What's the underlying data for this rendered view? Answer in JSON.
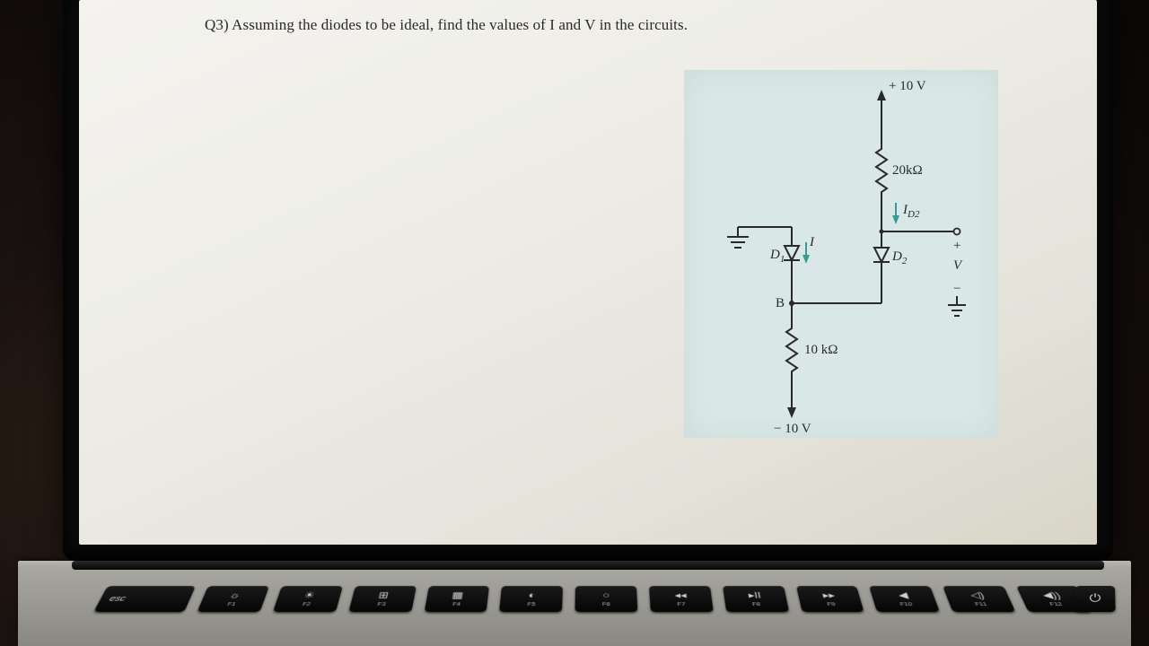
{
  "question": {
    "label": "Q3)",
    "text": "Assuming the diodes to be ideal, find the values of I and V in the circuits."
  },
  "circuit": {
    "top_voltage": "+ 10 V",
    "bottom_voltage": "− 10 V",
    "r_top": "20kΩ",
    "r_bottom": "10 kΩ",
    "i_d2": "I",
    "i_d2_sub": "D2",
    "d1": "D",
    "d1_sub": "1",
    "d2": "D",
    "d2_sub": "2",
    "i_label": "I",
    "v_label": "V",
    "node_b": "B",
    "plus": "+",
    "minus": "−"
  },
  "keyboard": {
    "esc": "esc",
    "keys": [
      {
        "sym": "☼",
        "fn": "F1"
      },
      {
        "sym": "☀",
        "fn": "F2"
      },
      {
        "sym": "⊞",
        "fn": "F3"
      },
      {
        "sym": "▦",
        "fn": "F4"
      },
      {
        "sym": "◐",
        "fn": "F5"
      },
      {
        "sym": "○",
        "fn": "F6"
      },
      {
        "sym": "◂◂",
        "fn": "F7"
      },
      {
        "sym": "▸II",
        "fn": "F8"
      },
      {
        "sym": "▸▸",
        "fn": "F9"
      },
      {
        "sym": "◀",
        "fn": "F10"
      },
      {
        "sym": "◁)",
        "fn": "F11"
      },
      {
        "sym": "◀))",
        "fn": "F12"
      }
    ],
    "power": "⏻"
  }
}
